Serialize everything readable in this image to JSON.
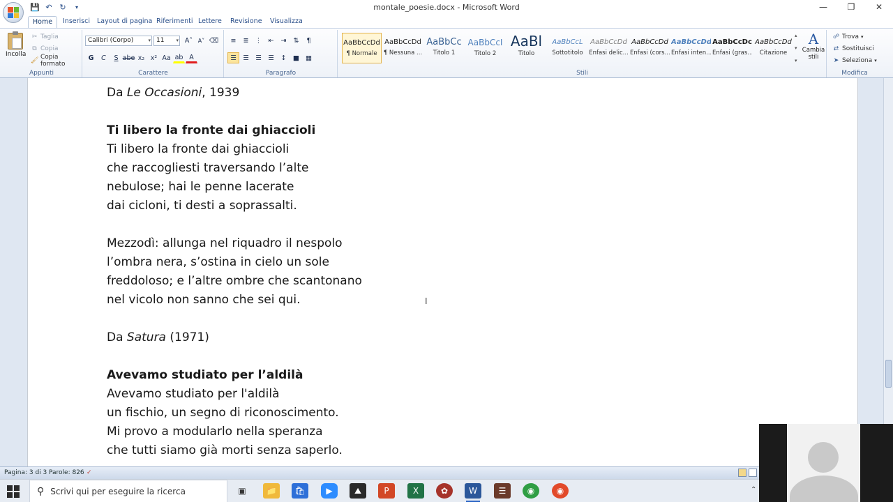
{
  "window": {
    "title": "montale_poesie.docx - Microsoft Word"
  },
  "tabs": [
    "Home",
    "Inserisci",
    "Layout di pagina",
    "Riferimenti",
    "Lettere",
    "Revisione",
    "Visualizza"
  ],
  "ribbon": {
    "clipboard": {
      "label": "Appunti",
      "paste": "Incolla",
      "cut": "Taglia",
      "copy": "Copia",
      "format_painter": "Copia formato"
    },
    "font": {
      "label": "Carattere",
      "font_name": "Calibri (Corpo)",
      "font_size": "11"
    },
    "paragraph": {
      "label": "Paragrafo"
    },
    "styles": {
      "label": "Stili",
      "sample": "AaBbCcDd",
      "items": [
        {
          "sample": "AaBbCcDd",
          "name": "¶ Normale"
        },
        {
          "sample": "AaBbCcDd",
          "name": "¶ Nessuna ..."
        },
        {
          "sample": "AaBbCc",
          "name": "Titolo 1"
        },
        {
          "sample": "AaBbCcI",
          "name": "Titolo 2"
        },
        {
          "sample": "AaBl",
          "name": "Titolo"
        },
        {
          "sample": "AaBbCcL",
          "name": "Sottotitolo"
        },
        {
          "sample": "AaBbCcDd",
          "name": "Enfasi delic..."
        },
        {
          "sample": "AaBbCcDd",
          "name": "Enfasi (cors..."
        },
        {
          "sample": "AaBbCcDd",
          "name": "Enfasi inten..."
        },
        {
          "sample": "AaBbCcDc",
          "name": "Enfasi (gras..."
        },
        {
          "sample": "AaBbCcDd",
          "name": "Citazione"
        }
      ],
      "change_styles": "Cambia stili"
    },
    "editing": {
      "label": "Modifica",
      "find": "Trova",
      "replace": "Sostituisci",
      "select": "Seleziona"
    }
  },
  "document": {
    "lines": [
      {
        "pre": "Da ",
        "it": "Le Occasioni",
        "post": ", 1939",
        "bold": false
      },
      {
        "pre": "",
        "it": "",
        "post": "",
        "bold": false
      },
      {
        "pre": "Ti libero la fronte dai ghiaccioli",
        "it": "",
        "post": "",
        "bold": true
      },
      {
        "pre": "Ti libero la fronte dai ghiaccioli",
        "it": "",
        "post": "",
        "bold": false
      },
      {
        "pre": "che raccogliesti traversando l’alte",
        "it": "",
        "post": "",
        "bold": false
      },
      {
        "pre": "nebulose; hai le penne lacerate",
        "it": "",
        "post": "",
        "bold": false
      },
      {
        "pre": "dai cicloni, ti desti a soprassalti.",
        "it": "",
        "post": "",
        "bold": false
      },
      {
        "pre": "",
        "it": "",
        "post": "",
        "bold": false
      },
      {
        "pre": "Mezzodì: allunga nel riquadro il nespolo",
        "it": "",
        "post": "",
        "bold": false
      },
      {
        "pre": "l’ombra nera, s’ostina in cielo un sole",
        "it": "",
        "post": "",
        "bold": false
      },
      {
        "pre": "freddoloso; e l’altre ombre che scantonano",
        "it": "",
        "post": "",
        "bold": false
      },
      {
        "pre": "nel vicolo non sanno che sei qui.",
        "it": "",
        "post": "",
        "bold": false
      },
      {
        "pre": "",
        "it": "",
        "post": "",
        "bold": false
      },
      {
        "pre": "Da ",
        "it": "Satura",
        "post": " (1971)",
        "bold": false
      },
      {
        "pre": "",
        "it": "",
        "post": "",
        "bold": false
      },
      {
        "pre": "Avevamo studiato per l’aldilà",
        "it": "",
        "post": "",
        "bold": true
      },
      {
        "pre": "Avevamo studiato per l'aldilà",
        "it": "",
        "post": "",
        "bold": false
      },
      {
        "pre": "un fischio, un segno di riconoscimento.",
        "it": "",
        "post": "",
        "bold": false
      },
      {
        "pre": "Mi provo a modularlo nella speranza",
        "it": "",
        "post": "",
        "bold": false
      },
      {
        "pre": "che tutti siamo già morti senza saperlo.",
        "it": "",
        "post": "",
        "bold": false
      }
    ]
  },
  "status": {
    "page": "Pagina: 3 di 3",
    "words": "Parole: 826"
  },
  "taskbar": {
    "search_placeholder": "Scrivi qui per eseguire la ricerca"
  },
  "colors": {
    "accent": "#2a4f8a",
    "word_blue": "#2b579a"
  }
}
